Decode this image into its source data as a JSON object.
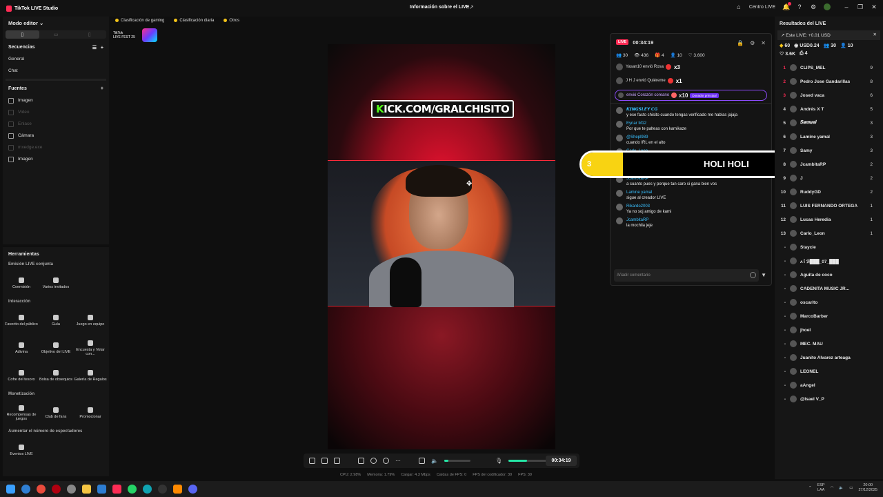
{
  "titlebar": {
    "app_title": "TikTok LIVE Studio",
    "center_title": "Información sobre el LIVE",
    "centro_live": "Centro LIVE",
    "notif_count": "1"
  },
  "left": {
    "mode_editor": "Modo editor",
    "secuencias": "Secuencias",
    "seq_items": [
      "General",
      "Chat"
    ],
    "fuentes": "Fuentes",
    "source_items": [
      "Imagen",
      "Video",
      "Enlace",
      "Cámara",
      "mxedge.exe",
      "Imagen"
    ]
  },
  "tools": {
    "title": "Herramientas",
    "sec_emision": "Emisión LIVE conjunta",
    "coemision": "Coemisión",
    "varios": "Varios invitados",
    "sec_interaccion": "Interacción",
    "favorito": "Favorito del público",
    "guia": "Guía",
    "juego_equipo": "Juego en equipo",
    "adivina": "Adivina",
    "objetivo": "Objetivo del LIVE",
    "encuesta": "Encuesta y Votar con...",
    "cofre": "Cofre del tesoro",
    "bolsa": "Bolsa de obsequios",
    "galeria": "Galería de Regalos",
    "sec_monetizacion": "Monetización",
    "recompensas": "Recompensas de juegos",
    "club": "Club de fans",
    "promocionar": "Promocionar",
    "sec_aumentar": "Aumentar el número de espectadores",
    "eventos": "Eventos LIVE"
  },
  "tabs": {
    "clasif_gaming": "Clasificación de gaming",
    "clasif_diaria": "Clasificación diaria",
    "otros": "Otros"
  },
  "fest": {
    "line1": "TikTok",
    "line2": "LIVE FEST 25"
  },
  "stage": {
    "kick_k": "K",
    "kick_rest": "ICK.COM/GRALCHISITO"
  },
  "controls": {
    "timer": "00:34:19",
    "mic_level": 0.45,
    "vol_level": 0.15
  },
  "stats": {
    "cpu": "CPU: 2.98%",
    "memoria": "Memoria: 1.79%",
    "cargar": "Cargar: 4.3 Mbps",
    "caidas": "Caídas de FPS: 0",
    "fps_cod": "FPS del codificador: 30",
    "fps": "FPS: 30"
  },
  "chat": {
    "live_tag": "LIVE",
    "time": "00:34:19",
    "stat_viewers": "30",
    "stat_views": "436",
    "stat_gifts": "4",
    "stat_users": "10",
    "stat_likes": "3.600",
    "gift1_text": "Yasan10 envió Rosa",
    "gift1_mult": "x3",
    "gift2_text": "J H J envió Quiéreme",
    "gift2_mult": "x1",
    "gift3_text": "envió Corazón coreano",
    "gift3_mult": "x10",
    "gift3_badge": "Donador principal",
    "messages": [
      {
        "user": "𝙆𝙄𝙉𝙂𝙎𝙇𝙀𝙔 𝘾𝙂",
        "text": "y ese facto chisito cuando tengas verificado me hablas jajaja"
      },
      {
        "user": "Eynar M12",
        "text": "Por que te palteas con kamikaze"
      },
      {
        "user": "@Shepl989",
        "text": "cuando IRL en el alto"
      },
      {
        "user": "Carlo_Leon",
        "text": "uy nooo sea serio cambie de camara"
      },
      {
        "user": "J",
        "text": "Te alzaste chisito"
      },
      {
        "user": "JcambitaRP",
        "text": "a cuanto pues y porque tan caro si gana bien vos"
      },
      {
        "user": "Lamine yamal",
        "text": "sigue al creador LIVE"
      },
      {
        "user": "Rikardo2003",
        "text": "Ya no soj amigo de kami"
      },
      {
        "user": "JcambitaRP",
        "text": "la mochila jeje"
      }
    ],
    "comment_placeholder": "Añadir comentario"
  },
  "overlay": {
    "rank": "3",
    "name": "HOLI HOLI",
    "count": "20"
  },
  "right": {
    "title": "Resultados del LIVE",
    "banner": "Este LIVE: +0.01 USD",
    "s1": "60",
    "s2": "USD0.24",
    "s3": "30",
    "s4": "10",
    "s5": "3.6K",
    "s6": "4",
    "ranks": [
      {
        "n": "1",
        "name": "CLIPS_MEL",
        "score": "9"
      },
      {
        "n": "2",
        "name": "Pedro Jose Gandarillas",
        "score": "8"
      },
      {
        "n": "3",
        "name": "Josed vaca",
        "score": "6"
      },
      {
        "n": "4",
        "name": "Andrés X T",
        "score": "5"
      },
      {
        "n": "5",
        "name": "𝑺𝒂𝒎𝒖𝒆𝒍",
        "score": "3"
      },
      {
        "n": "6",
        "name": "Lamine yamal",
        "score": "3"
      },
      {
        "n": "7",
        "name": "Samy",
        "score": "3"
      },
      {
        "n": "8",
        "name": "JcambitaRP",
        "score": "2"
      },
      {
        "n": "9",
        "name": "J",
        "score": "2"
      },
      {
        "n": "10",
        "name": "RuddyGD",
        "score": "2"
      },
      {
        "n": "11",
        "name": "LUIS FERNANDO ORTEGA",
        "score": "1"
      },
      {
        "n": "12",
        "name": "Lucas Heredia",
        "score": "1"
      },
      {
        "n": "13",
        "name": "Carlo_Leon",
        "score": "1"
      },
      {
        "n": "-",
        "name": "Staycie",
        "score": ""
      },
      {
        "n": "-",
        "name": "ʌ꒰ℬ███_07_███",
        "score": ""
      },
      {
        "n": "-",
        "name": "Aguita de coco",
        "score": ""
      },
      {
        "n": "-",
        "name": "CADENITA MUSIC JR...",
        "score": ""
      },
      {
        "n": "-",
        "name": "oscarito",
        "score": ""
      },
      {
        "n": "-",
        "name": "MarcoBarber",
        "score": ""
      },
      {
        "n": "-",
        "name": "jhoel",
        "score": ""
      },
      {
        "n": "-",
        "name": "MEC. MAU",
        "score": ""
      },
      {
        "n": "-",
        "name": "Juanito Alvarez arteaga",
        "score": ""
      },
      {
        "n": "-",
        "name": "LEONEL",
        "score": ""
      },
      {
        "n": "-",
        "name": "aAngel",
        "score": ""
      },
      {
        "n": "-",
        "name": "@Isael V_P",
        "score": ""
      }
    ]
  },
  "taskbar": {
    "lang1": "ESP",
    "lang2": "LAA",
    "time": "20:00",
    "date": "27/12/2025"
  }
}
